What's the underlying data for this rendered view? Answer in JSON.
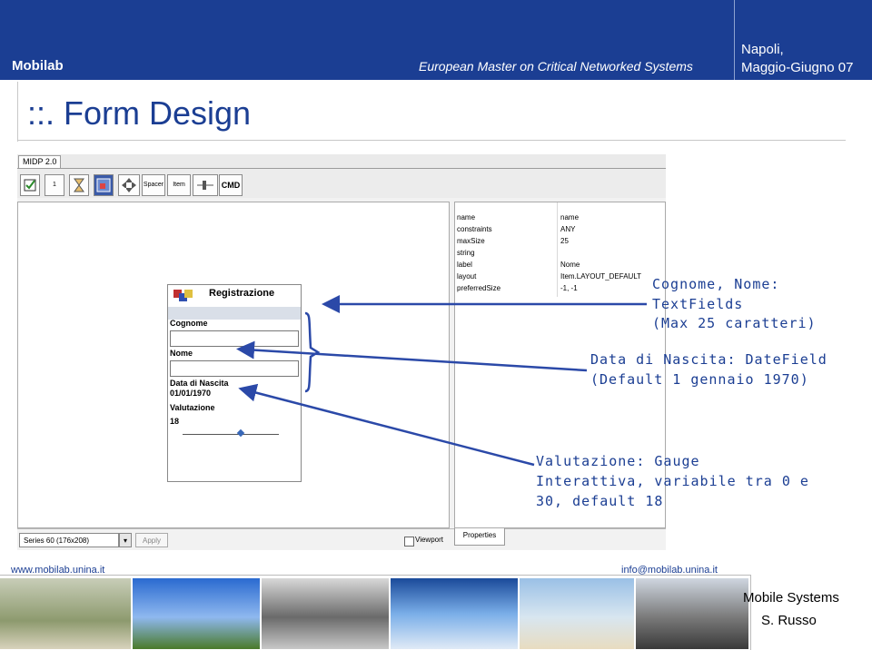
{
  "header": {
    "brand": "Mobilab",
    "course": "European Master on Critical Networked Systems",
    "city": "Napoli,",
    "dates": "Maggio-Giugno 07"
  },
  "slide": {
    "title": "::. Form Design"
  },
  "ide": {
    "tab": "MIDP 2.0",
    "toolbar": [
      {
        "label": "",
        "icon": "checkbox-icon"
      },
      {
        "label": "1",
        "icon": "textbox-icon"
      },
      {
        "label": "",
        "icon": "hourglass-icon"
      },
      {
        "label": "",
        "icon": "image-icon"
      },
      {
        "label": "",
        "icon": "move-icon"
      },
      {
        "label": "Spacer",
        "icon": "spacer-icon"
      },
      {
        "label": "Item",
        "icon": "item-icon"
      },
      {
        "label": "",
        "icon": "gauge-icon"
      },
      {
        "label": "CMD",
        "icon": "command-icon"
      }
    ],
    "device_series": "Series 60 (176x208)",
    "apply_label": "Apply",
    "viewport_label": "Viewport",
    "properties_tab": "Properties",
    "properties": [
      {
        "name": "name",
        "value": "name"
      },
      {
        "name": "constraints",
        "value": "ANY"
      },
      {
        "name": "maxSize",
        "value": "25"
      },
      {
        "name": "string",
        "value": ""
      },
      {
        "name": "label",
        "value": "Nome"
      },
      {
        "name": "layout",
        "value": "Item.LAYOUT_DEFAULT"
      },
      {
        "name": "preferredSize",
        "value": "-1, -1"
      }
    ]
  },
  "form": {
    "title": "Registrazione",
    "cognome": "Cognome",
    "nome": "Nome",
    "data_label": "Data di Nascita",
    "data_value": "01/01/1970",
    "valutazione_label": "Valutazione",
    "valutazione_value": "18",
    "gauge": {
      "min": 0,
      "max": 30,
      "value": 18
    }
  },
  "annotations": {
    "a1_l1": "Cognome, Nome:",
    "a1_l2": "TextFields",
    "a1_l3": "(Max 25 caratteri)",
    "a2_l1": "Data di Nascita: DateField",
    "a2_l2": "(Default 1 gennaio 1970)",
    "a3_l1": "Valutazione: Gauge",
    "a3_l2": "Interattiva, variabile tra 0 e",
    "a3_l3": "30, default 18"
  },
  "footer": {
    "website": "www.mobilab.unina.it",
    "email": "info@mobilab.unina.it",
    "course": "Mobile Systems",
    "author": "S. Russo"
  },
  "colors": {
    "brand": "#1b3e93"
  }
}
